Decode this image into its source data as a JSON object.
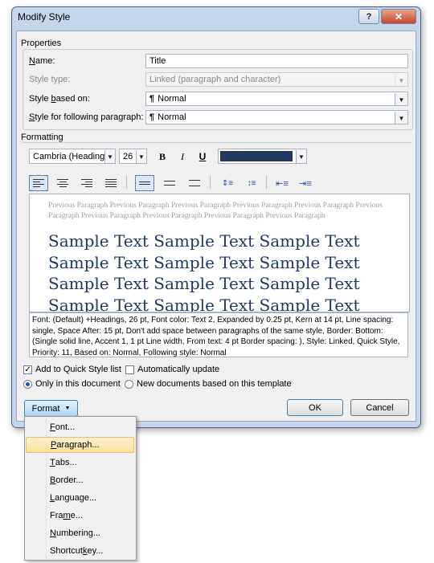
{
  "dialog": {
    "title": "Modify Style",
    "help_label": "?",
    "close_label": "✕"
  },
  "properties": {
    "group_label": "Properties",
    "name": {
      "label": "Name:",
      "value": "Title"
    },
    "style_type": {
      "label": "Style type:",
      "value": "Linked (paragraph and character)"
    },
    "based_on": {
      "label": "Style based on:",
      "value": "Normal",
      "mark": "¶"
    },
    "following": {
      "label": "Style for following paragraph:",
      "value": "Normal",
      "mark": "¶"
    }
  },
  "formatting": {
    "group_label": "Formatting",
    "font": "Cambria (Headings)",
    "size": "26",
    "bold": "B",
    "italic": "I",
    "underline": "U",
    "color": "#1f3864"
  },
  "preview": {
    "previous_line1": "Previous Paragraph Previous Paragraph Previous Paragraph Previous Paragraph Previous Paragraph Previous",
    "previous_line2": "Paragraph Previous Paragraph Previous Paragraph Previous Paragraph Previous Paragraph",
    "sample_lines": [
      "Sample Text Sample Text Sample Text",
      "Sample Text Sample Text Sample Text",
      "Sample Text Sample Text Sample Text",
      "Sample Text Sample Text Sample Text"
    ]
  },
  "description": "Font: (Default) +Headings, 26 pt, Font color: Text 2, Expanded by  0.25 pt, Kern at 14 pt, Line spacing:  single, Space After:  15 pt, Don't add space between paragraphs of the same style, Border: Bottom: (Single solid line, Accent 1,  1 pt Line width, From text:  4 pt Border spacing: ), Style: Linked, Quick Style, Priority: 11, Based on: Normal, Following style: Normal",
  "options": {
    "add_quick_style": {
      "label": "Add to Quick Style list",
      "checked": true
    },
    "auto_update": {
      "label": "Automatically update",
      "checked": false
    },
    "only_this_doc": {
      "label": "Only in this document",
      "selected": true
    },
    "new_docs": {
      "label": "New documents based on this template",
      "selected": false
    }
  },
  "buttons": {
    "format": "Format",
    "ok": "OK",
    "cancel": "Cancel"
  },
  "format_menu": {
    "items": [
      "Font...",
      "Paragraph...",
      "Tabs...",
      "Border...",
      "Language...",
      "Frame...",
      "Numbering...",
      "Shortcut key..."
    ],
    "highlighted": "Paragraph..."
  }
}
